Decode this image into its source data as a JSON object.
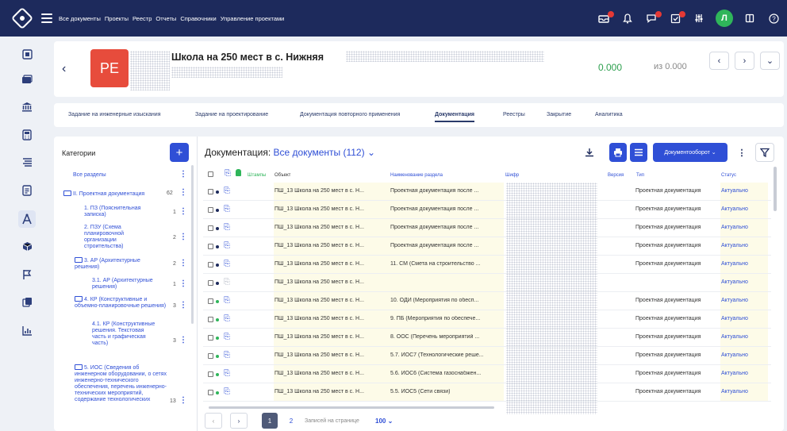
{
  "nav": [
    "Все документы",
    "Проекты",
    "Реестр",
    "Отчеты",
    "Справочники",
    "Управление проектами"
  ],
  "top_icons": [
    "inbox-icon",
    "bell-icon",
    "chat-icon",
    "tasks-icon",
    "settings-sliders-icon"
  ],
  "user": {
    "initial": "Л"
  },
  "extra_icons": [
    "book-icon",
    "help-icon"
  ],
  "rail_icons": [
    "dashboard-icon",
    "folders-icon",
    "bank-icon",
    "calculator-icon",
    "list-tree-icon",
    "document-icon",
    "compass-icon",
    "box-icon",
    "flag-icon",
    "copy-icon",
    "chart-icon"
  ],
  "project": {
    "badge": "PE",
    "title": "Школа на 250 мест в с. Нижняя",
    "amount": "0.000",
    "amount_total": "из 0.000"
  },
  "tabs": [
    "Задание на инженерные изыскания",
    "Задание на проектирование",
    "Документация повторного применения",
    "Документация",
    "Реестры",
    "Закрытие",
    "Аналитика"
  ],
  "active_tab": "Документация",
  "categories": {
    "title": "Категории",
    "items": [
      {
        "label": "Все разделы",
        "count": ""
      },
      {
        "label": "II. Проектная документация",
        "count": "62"
      },
      {
        "label": "1. ПЗ (Пояснительная записка)",
        "count": "1"
      },
      {
        "label": "2. ПЗУ (Схема планировочной организации строительства)",
        "count": "2"
      },
      {
        "label": "3. АР (Архитектурные решения)",
        "count": "2"
      },
      {
        "label": "3.1. АР (Архитектурные решения)",
        "count": "1"
      },
      {
        "label": "4. КР (Конструктивные и объемно-планировочные решения)",
        "count": "3"
      },
      {
        "label": "4.1. КР (Конструктивные решения. Текстовая часть и графическая часть)",
        "count": "3"
      },
      {
        "label": "5. ИОС (Сведения об инженерном оборудовании, о сетях инженерно-технического обеспечения, перечень инженерно-технических мероприятий, содержание технологических",
        "count": "13"
      }
    ]
  },
  "documents": {
    "title": "Документация:",
    "filter": "Все документы (112)",
    "workflow_button": "Документооборот",
    "columns": [
      "Штампы",
      "Объект",
      "Наименование раздела",
      "Шифр",
      "Версия",
      "Тип",
      "Статус"
    ],
    "rows": [
      {
        "object": "ПШ_13 Школа на 250 мест в с. Н...",
        "section": "Проектная документация после ...",
        "type": "Проектная документация",
        "status": "Актуально",
        "dot": "dark",
        "clip": "blue"
      },
      {
        "object": "ПШ_13 Школа на 250 мест в с. Н...",
        "section": "Проектная документация после ...",
        "type": "Проектная документация",
        "status": "Актуально",
        "dot": "dark",
        "clip": "blue"
      },
      {
        "object": "ПШ_13 Школа на 250 мест в с. Н...",
        "section": "Проектная документация после ...",
        "type": "Проектная документация",
        "status": "Актуально",
        "dot": "dark",
        "clip": "blue"
      },
      {
        "object": "ПШ_13 Школа на 250 мест в с. Н...",
        "section": "Проектная документация после ...",
        "type": "Проектная документация",
        "status": "Актуально",
        "dot": "dark",
        "clip": "blue"
      },
      {
        "object": "ПШ_13 Школа на 250 мест в с. Н...",
        "section": "11. СМ (Смета на строительство ...",
        "type": "Проектная документация",
        "status": "Актуально",
        "dot": "dark",
        "clip": "blue"
      },
      {
        "object": "ПШ_13 Школа на 250 мест в с. Н...",
        "section": "",
        "type": "",
        "status": "Актуально",
        "dot": "dark",
        "clip": "grey"
      },
      {
        "object": "ПШ_13 Школа на 250 мест в с. Н...",
        "section": "10. ОДИ (Мероприятия по обесп...",
        "type": "Проектная документация",
        "status": "Актуально",
        "dot": "green",
        "clip": "blue"
      },
      {
        "object": "ПШ_13 Школа на 250 мест в с. Н...",
        "section": "9. ПБ (Мероприятия по обеспече...",
        "type": "Проектная документация",
        "status": "Актуально",
        "dot": "green",
        "clip": "blue"
      },
      {
        "object": "ПШ_13 Школа на 250 мест в с. Н...",
        "section": "8. ООС (Перечень мероприятий ...",
        "type": "Проектная документация",
        "status": "Актуально",
        "dot": "green",
        "clip": "blue"
      },
      {
        "object": "ПШ_13 Школа на 250 мест в с. Н...",
        "section": "5.7. ИОС7 (Технологические реше...",
        "type": "Проектная документация",
        "status": "Актуально",
        "dot": "green",
        "clip": "blue"
      },
      {
        "object": "ПШ_13 Школа на 250 мест в с. Н...",
        "section": "5.6. ИОС6 (Система газоснабжен...",
        "type": "Проектная документация",
        "status": "Актуально",
        "dot": "green",
        "clip": "blue"
      },
      {
        "object": "ПШ_13 Школа на 250 мест в с. Н...",
        "section": "5.5. ИОС5 (Сети связи)",
        "type": "Проектная документация",
        "status": "Актуально",
        "dot": "green",
        "clip": "blue"
      }
    ]
  },
  "pagination": {
    "pages": [
      "1",
      "2"
    ],
    "current": "1",
    "per_page_label": "Записей на странице",
    "per_page": "100"
  },
  "colors": {
    "topbar": "#1d2a5c",
    "accent": "#2f4fd6",
    "badge": "#e74c3c",
    "success": "#2fb55a"
  }
}
